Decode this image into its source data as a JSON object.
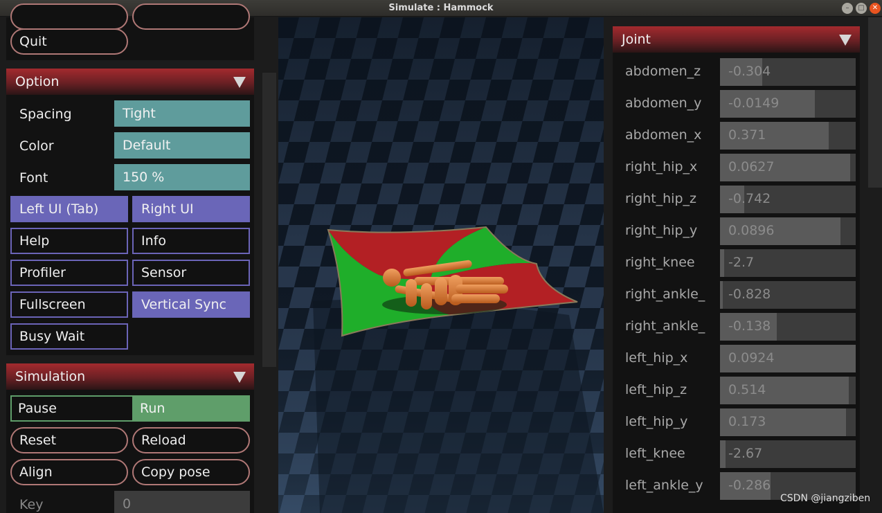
{
  "window": {
    "title": "Simulate : Hammock"
  },
  "top_section": {
    "quit_label": "Quit"
  },
  "option": {
    "title": "Option",
    "spacing_label": "Spacing",
    "spacing_value": "Tight",
    "color_label": "Color",
    "color_value": "Default",
    "font_label": "Font",
    "font_value": "150 %",
    "left_ui": "Left UI (Tab)",
    "right_ui": "Right UI",
    "help": "Help",
    "info": "Info",
    "profiler": "Profiler",
    "sensor": "Sensor",
    "fullscreen": "Fullscreen",
    "vertical_sync": "Vertical Sync",
    "busy_wait": "Busy Wait"
  },
  "simulation": {
    "title": "Simulation",
    "pause": "Pause",
    "run": "Run",
    "reset": "Reset",
    "reload": "Reload",
    "align": "Align",
    "copy_pose": "Copy pose",
    "key_label": "Key",
    "key_value": "0"
  },
  "joint": {
    "title": "Joint",
    "items": [
      {
        "name": "abdomen_z",
        "value": "-0.304",
        "fill": 0.31
      },
      {
        "name": "abdomen_y",
        "value": "-0.0149",
        "fill": 0.7
      },
      {
        "name": "abdomen_x",
        "value": "0.371",
        "fill": 0.8
      },
      {
        "name": "right_hip_x",
        "value": "0.0627",
        "fill": 0.96
      },
      {
        "name": "right_hip_z",
        "value": "-0.742",
        "fill": 0.18
      },
      {
        "name": "right_hip_y",
        "value": "0.0896",
        "fill": 0.89
      },
      {
        "name": "right_knee",
        "value": "-2.7",
        "fill": 0.03
      },
      {
        "name": "right_ankle_",
        "value": "-0.828",
        "fill": 0.02
      },
      {
        "name": "right_ankle_",
        "value": "-0.138",
        "fill": 0.42
      },
      {
        "name": "left_hip_x",
        "value": "0.0924",
        "fill": 1.0
      },
      {
        "name": "left_hip_z",
        "value": "0.514",
        "fill": 0.95
      },
      {
        "name": "left_hip_y",
        "value": "0.173",
        "fill": 0.93
      },
      {
        "name": "left_knee",
        "value": "-2.67",
        "fill": 0.04
      },
      {
        "name": "left_ankle_y",
        "value": "-0.286",
        "fill": 0.37
      }
    ]
  },
  "watermark": "CSDN @jiangziben",
  "colors": {
    "section_header": "#a32a2e",
    "teal": "#5f9c9c",
    "toggle_on": "#6a66b8",
    "run_green": "#5f9e6a",
    "hammock_red": "#b32024",
    "hammock_green": "#1fae2a",
    "body_orange": "#d8752e"
  },
  "icons": {
    "section_toggle": "triangle-down-icon"
  }
}
